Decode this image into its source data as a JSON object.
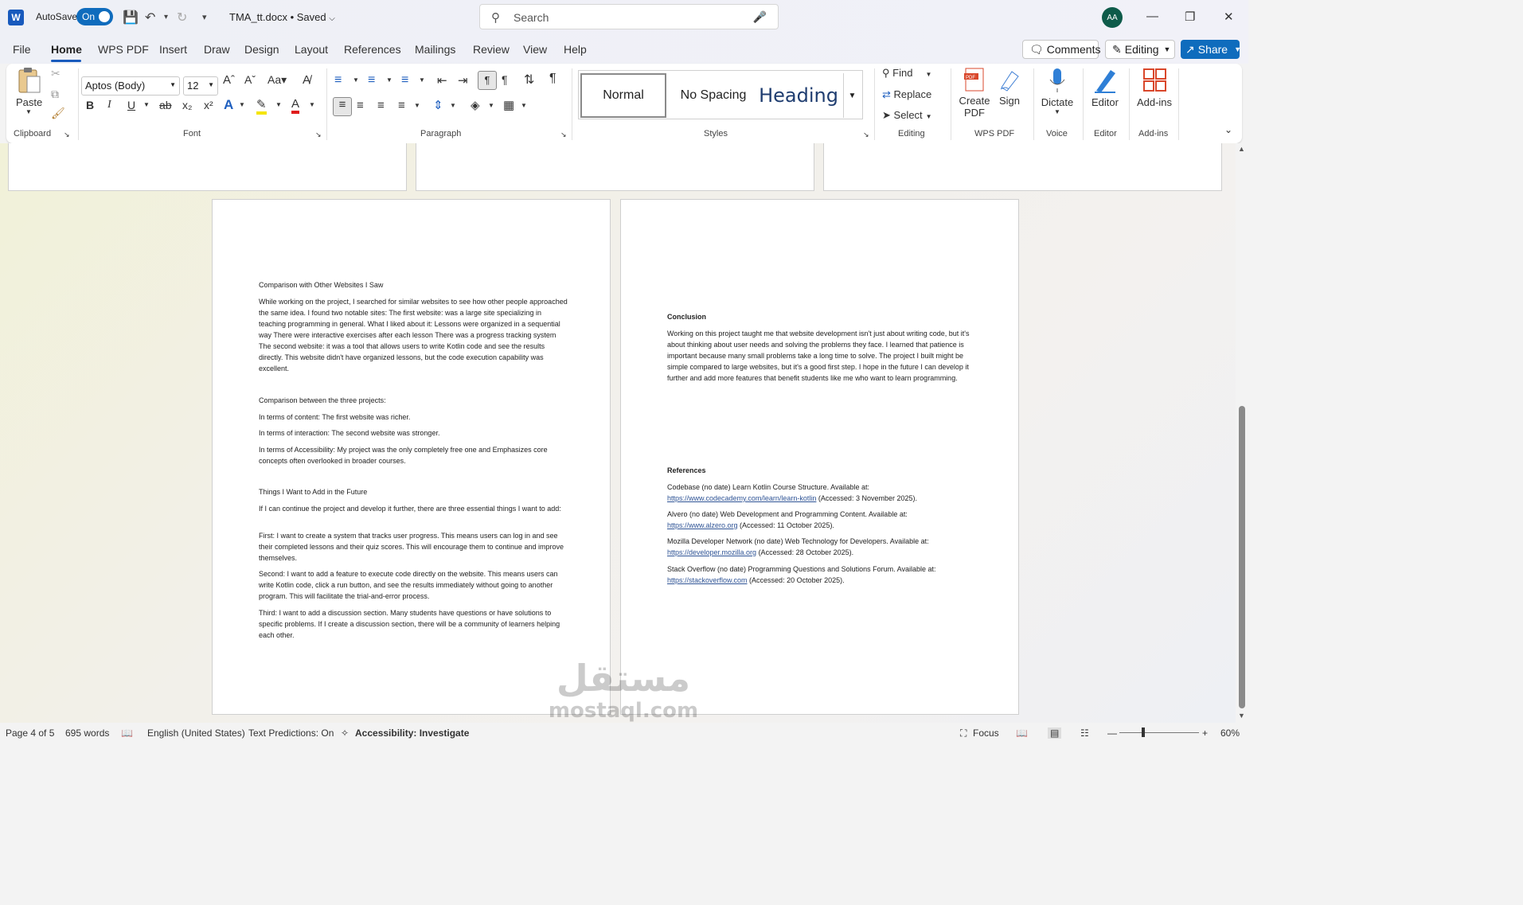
{
  "titlebar": {
    "autosave": "AutoSave",
    "toggle": "On",
    "doc_name": "TMA_tt.docx • Saved",
    "search_placeholder": "Search",
    "avatar": "AA"
  },
  "menu": {
    "tabs": [
      "File",
      "Home",
      "WPS PDF",
      "Insert",
      "Draw",
      "Design",
      "Layout",
      "References",
      "Mailings",
      "Review",
      "View",
      "Help"
    ],
    "comments": "Comments",
    "editing": "Editing",
    "share": "Share"
  },
  "ribbon": {
    "clipboard": {
      "paste": "Paste",
      "label": "Clipboard"
    },
    "font": {
      "name": "Aptos (Body)",
      "size": "12",
      "label": "Font"
    },
    "paragraph": {
      "label": "Paragraph"
    },
    "styles": {
      "items": [
        "Normal",
        "No Spacing",
        "Heading"
      ],
      "label": "Styles"
    },
    "editing": {
      "find": "Find",
      "replace": "Replace",
      "select": "Select",
      "label": "Editing"
    },
    "wps": {
      "create": "Create",
      "pdf": "PDF",
      "sign": "Sign",
      "label": "WPS PDF"
    },
    "voice": {
      "dictate": "Dictate",
      "label": "Voice"
    },
    "editor": {
      "editor": "Editor",
      "label": "Editor"
    },
    "addins": {
      "addins": "Add-ins",
      "label": "Add-ins"
    }
  },
  "page_left": [
    {
      "t": "Comparison with Other Websites I Saw",
      "b": false
    },
    {
      "t": "While working on the project, I searched for similar websites to see how other people approached the same idea. I found two notable sites: The first website: was a large site specializing in teaching programming in general. What I liked about it: Lessons were organized in a sequential way There were interactive exercises after each lesson There was a progress tracking system The second website: it was a tool that allows users to write Kotlin code and see the results directly. This website didn't have organized lessons, but the code execution capability was excellent.",
      "b": false
    },
    {
      "t": "Comparison between the three projects:",
      "b": false
    },
    {
      "t": "In terms of content: The first website was richer.",
      "b": false
    },
    {
      "t": "In terms of interaction: The second website was stronger.",
      "b": false
    },
    {
      "t": "In terms of Accessibility: My project was the only completely free one and Emphasizes core concepts often overlooked in broader courses.",
      "b": false
    },
    {
      "t": "Things I Want to Add in the Future",
      "b": false
    },
    {
      "t": "If I can continue the project and develop it further, there are three essential things I want to add:",
      "b": false
    },
    {
      "t": "First: I want to create a system that tracks user progress. This means users can log in and see their completed lessons and their quiz scores. This will encourage them to continue and improve themselves.",
      "b": false
    },
    {
      "t": "Second: I want to add a feature to execute code directly on the website. This means users can write Kotlin code, click a run button, and see the results immediately without going to another program. This will facilitate the trial-and-error process.",
      "b": false
    },
    {
      "t": "Third: I want to add a discussion section. Many students have questions or have solutions to specific problems. If I create a discussion section, there will be a community of learners helping each other.",
      "b": false
    }
  ],
  "page_right": {
    "conclusion_title": "Conclusion",
    "conclusion": "Working on this project taught me that website development isn't just about writing code, but it's about thinking about user needs and solving the problems they face. I learned that patience is important because many small problems take a long time to solve. The project I built might be simple compared to large websites, but it's a good first step. I hope in the future I can develop it further and add more features that benefit students like me who want to learn programming.",
    "references_title": "References",
    "references": [
      {
        "pre": "Codebase (no date) Learn Kotlin Course Structure. Available at:",
        "link": "https://www.codecademy.com/learn/learn-kotlin",
        "post": " (Accessed: 3 November 2025)."
      },
      {
        "pre": "Alvero (no date) Web Development and Programming Content. Available at:",
        "link": "https://www.alzero.org",
        "post": " (Accessed: 11 October 2025)."
      },
      {
        "pre": "Mozilla Developer Network (no date) Web Technology for Developers. Available at:",
        "link": "https://developer.mozilla.org",
        "post": " (Accessed: 28 October 2025)."
      },
      {
        "pre": "Stack Overflow (no date) Programming Questions and Solutions Forum. Available at:",
        "link": "https://stackoverflow.com",
        "post": " (Accessed: 20 October 2025)."
      }
    ]
  },
  "watermark": {
    "arabic": "مستقل",
    "latin": "mostaql.com"
  },
  "status": {
    "page": "Page 4 of 5",
    "words": "695 words",
    "lang": "English (United States)",
    "predictions": "Text Predictions: On",
    "access": "Accessibility: Investigate",
    "focus": "Focus",
    "zoom": "60%"
  }
}
